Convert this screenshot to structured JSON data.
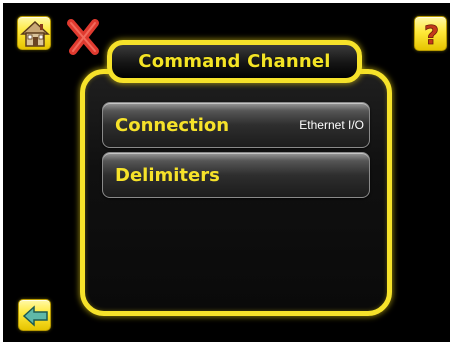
{
  "header": {
    "title": "Command Channel"
  },
  "toolbar": {
    "home_icon": "home-icon",
    "close_icon": "close-icon",
    "help_icon": "help-icon",
    "back_icon": "back-arrow-icon"
  },
  "menu": {
    "items": [
      {
        "label": "Connection",
        "value": "Ethernet I/O"
      },
      {
        "label": "Delimiters",
        "value": ""
      }
    ]
  },
  "colors": {
    "accent": "#f6e22a",
    "background": "#000000",
    "row_text": "#f6e22a",
    "value_text": "#ffffff"
  }
}
